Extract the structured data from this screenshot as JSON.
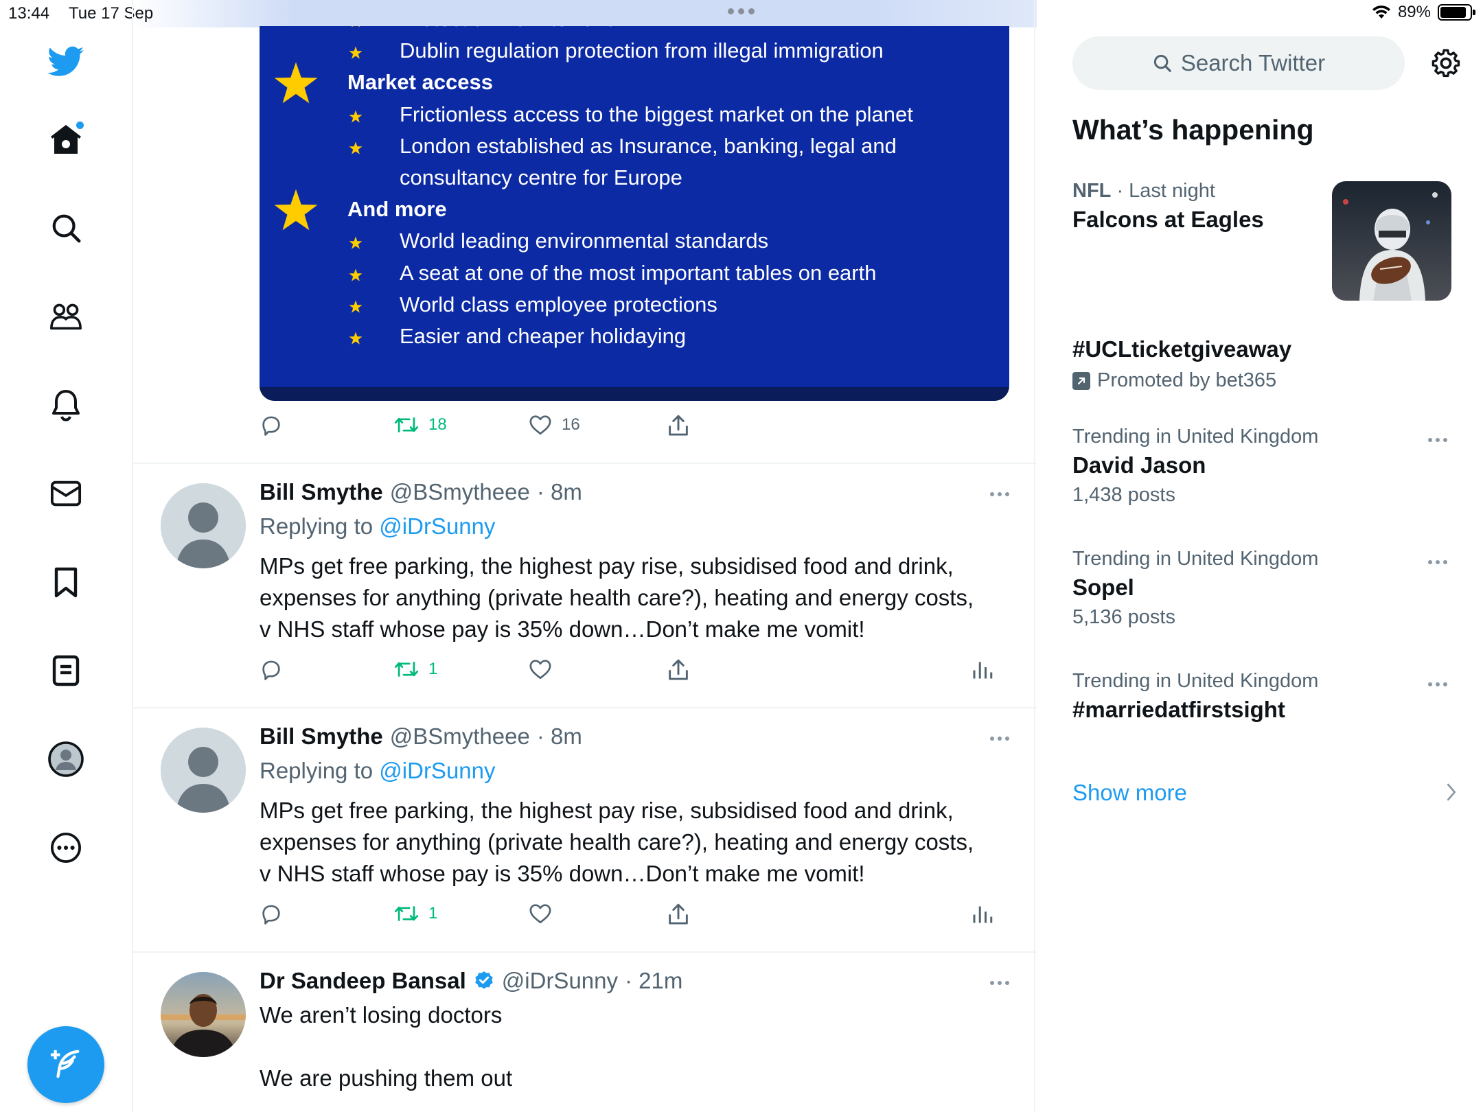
{
  "status_bar": {
    "time": "13:44",
    "date": "Tue 17 Sep",
    "battery": "89%",
    "battery_level": 0.89
  },
  "nav": {
    "icons": [
      "twitter-logo-icon",
      "home-icon",
      "explore-icon",
      "communities-icon",
      "notifications-icon",
      "messages-icon",
      "bookmarks-icon",
      "lists-icon",
      "profile-icon",
      "more-icon",
      "compose-icon"
    ]
  },
  "colors": {
    "accent": "#1d9bf0",
    "retweet": "#00ba7c",
    "eu_blue": "#0c2aa4",
    "eu_star": "#ffcc00",
    "muted": "#536471"
  },
  "media": {
    "lines": [
      {
        "kind": "item",
        "text": "Protection from terrorism"
      },
      {
        "kind": "item",
        "text": "Dublin regulation protection from illegal immigration"
      },
      {
        "kind": "section",
        "text": "Market access"
      },
      {
        "kind": "item",
        "text": "Frictionless access to the biggest market on the planet"
      },
      {
        "kind": "item",
        "text": "London established as Insurance, banking, legal and"
      },
      {
        "kind": "cont",
        "text": "consultancy centre for Europe"
      },
      {
        "kind": "section",
        "text": "And more"
      },
      {
        "kind": "item",
        "text": "World leading environmental standards"
      },
      {
        "kind": "item",
        "text": "A seat at one of the most important tables on earth"
      },
      {
        "kind": "item",
        "text": "World class employee protections"
      },
      {
        "kind": "item",
        "text": "Easier and cheaper holidaying"
      }
    ]
  },
  "first_actions": {
    "retweets": "18",
    "likes": "16"
  },
  "tweets": [
    {
      "name": "Bill Smythe",
      "handle": "@BSmytheee",
      "time": "· 8m",
      "replying_label": "Replying to",
      "replying_to": "@iDrSunny",
      "lines": [
        "MPs get free parking, the highest pay rise, subsidised food and drink,",
        "expenses for anything (private health care?), heating and energy costs,",
        "v NHS staff whose pay is 35% down…Don’t make me vomit!"
      ],
      "retweets": "1"
    },
    {
      "name": "Bill Smythe",
      "handle": "@BSmytheee",
      "time": "· 8m",
      "replying_label": "Replying to",
      "replying_to": "@iDrSunny",
      "lines": [
        "MPs get free parking, the highest pay rise, subsidised food and drink,",
        "expenses for anything (private health care?), heating and energy costs,",
        "v NHS staff whose pay is 35% down…Don’t make me vomit!"
      ],
      "retweets": "1"
    },
    {
      "name": "Dr Sandeep Bansal",
      "handle": "@iDrSunny",
      "time": "· 21m",
      "verified": true,
      "lines": [
        "We aren’t losing doctors",
        "",
        "We are pushing them out"
      ]
    }
  ],
  "sidebar": {
    "search_placeholder": "Search Twitter",
    "title": "What’s happening",
    "trends": [
      {
        "category": "NFL",
        "meta": "· Last night",
        "title": "Falcons at Eagles"
      },
      {
        "title": "#UCLticketgiveaway",
        "promoted": "Promoted by bet365"
      },
      {
        "meta": "Trending in United Kingdom",
        "title": "David Jason",
        "count": "1,438 posts"
      },
      {
        "meta": "Trending in United Kingdom",
        "title": "Sopel",
        "count": "5,136 posts"
      },
      {
        "meta": "Trending in United Kingdom",
        "title": "#marriedatfirstsight"
      }
    ],
    "show_more": "Show more"
  }
}
